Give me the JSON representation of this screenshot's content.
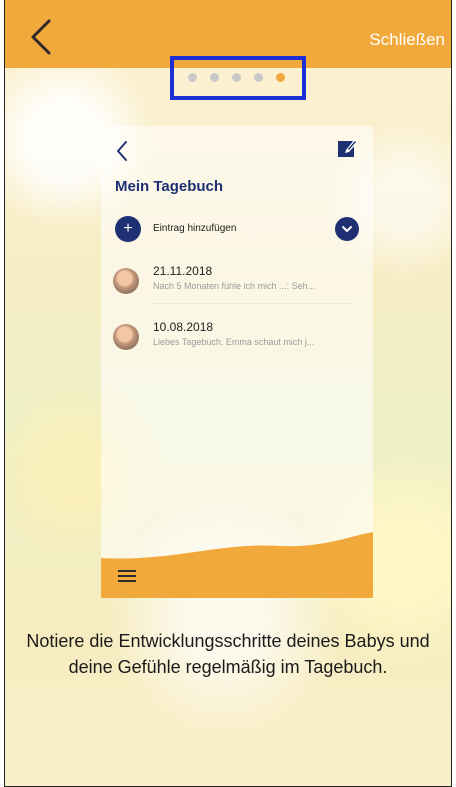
{
  "header": {
    "close_label": "Schließen",
    "back_icon": "chevron-left-icon",
    "accent_color": "#f2a93b"
  },
  "pager": {
    "total": 5,
    "active_index": 4,
    "highlight_color": "#1f2fd6"
  },
  "preview": {
    "title": "Mein Tagebuch",
    "add_entry_label": "Eintrag hinzufügen",
    "add_icon_glyph": "+",
    "entries": [
      {
        "date": "21.11.2018",
        "text": "Nach 5 Monaten fühle ich mich ...: Seh..."
      },
      {
        "date": "10.08.2018",
        "text": "Liebes Tagebuch, Emma schaut mich j..."
      }
    ],
    "primary_color": "#1f3072"
  },
  "caption": "Notiere die Entwicklungsschritte deines Babys und deine Gefühle regelmäßig im Tagebuch."
}
